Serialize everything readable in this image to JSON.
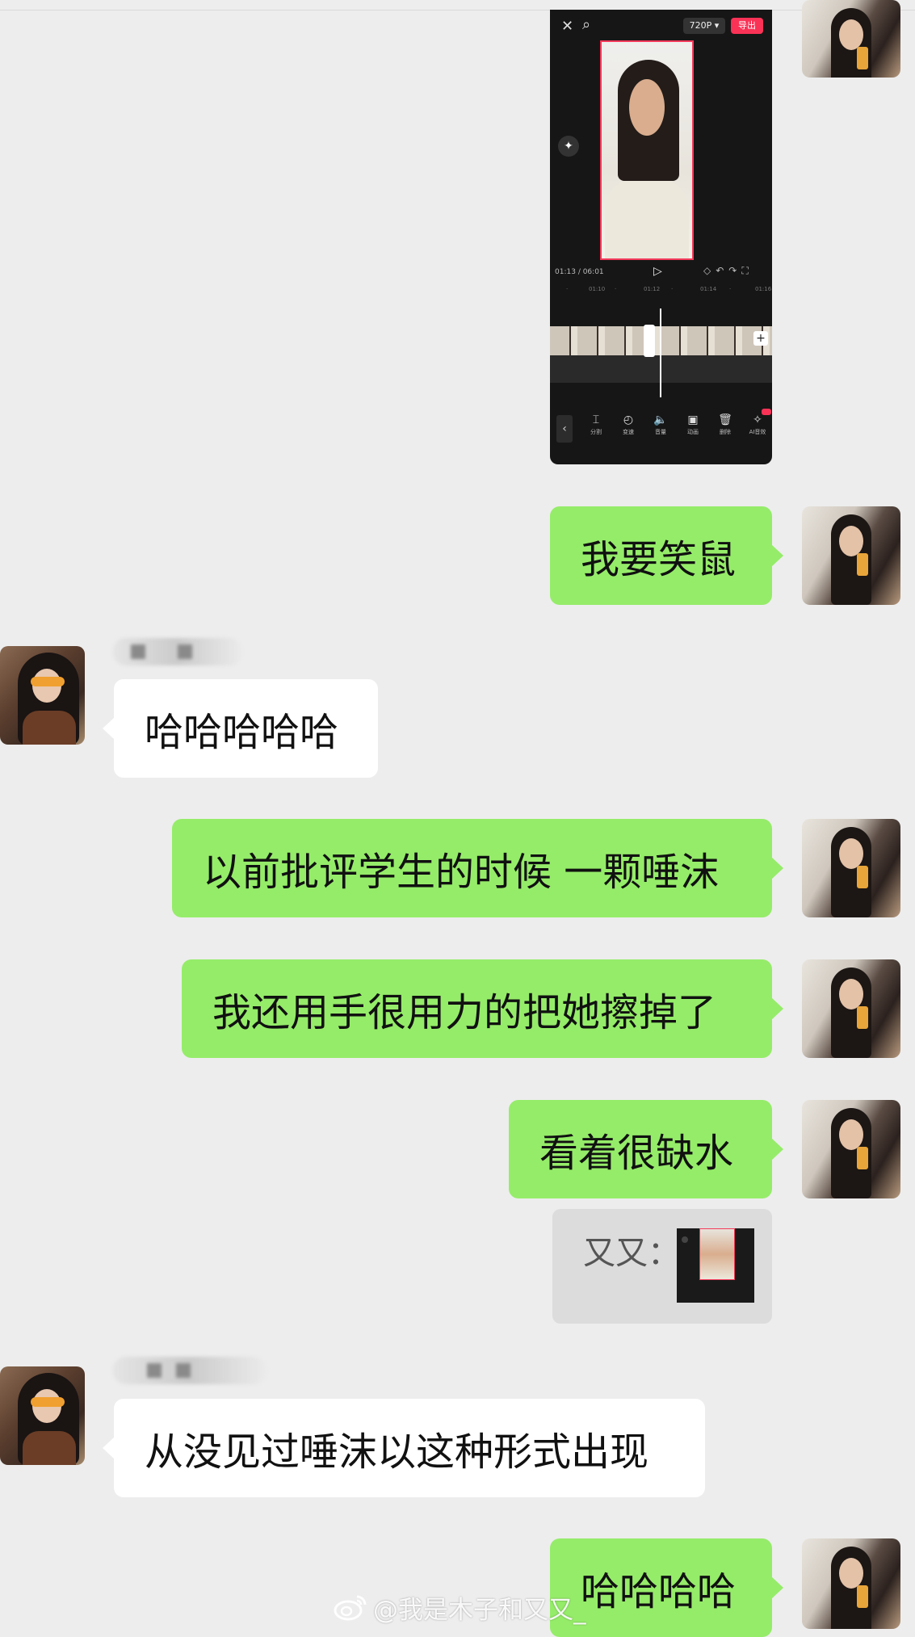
{
  "screenshot": {
    "resolution": "720P",
    "resolution_arrow": "▾",
    "export_label": "导出",
    "time_current": "01:13",
    "time_total": "/ 06:01",
    "ruler": [
      "·",
      "01:10",
      "·",
      "01:12",
      "·",
      "01:14",
      "·",
      "01:16"
    ],
    "tools": [
      {
        "icon": "split-icon",
        "glyph": "⌶",
        "label": "分割"
      },
      {
        "icon": "speed-icon",
        "glyph": "◴",
        "label": "变速"
      },
      {
        "icon": "volume-icon",
        "glyph": "🔈",
        "label": "音量"
      },
      {
        "icon": "animation-icon",
        "glyph": "▣",
        "label": "动画"
      },
      {
        "icon": "delete-icon",
        "glyph": "🗑",
        "label": "删除"
      },
      {
        "icon": "ai-effect-icon",
        "glyph": "✧",
        "label": "AI音效"
      }
    ]
  },
  "messages": {
    "m1": "我要笑鼠",
    "m2": "哈哈哈哈哈",
    "m3": "以前批评学生的时候 一颗唾沫",
    "m4": "我还用手很用力的把她擦掉了",
    "m5": "看着很缺水",
    "quote_label": "又又：",
    "m6": "从没见过唾沫以这种形式出现",
    "m7": "哈哈哈哈"
  },
  "watermark": "@我是木子和又又_",
  "colors": {
    "background": "#ededed",
    "my_bubble": "#95ec69",
    "other_bubble": "#ffffff",
    "export_button": "#fa3256"
  }
}
